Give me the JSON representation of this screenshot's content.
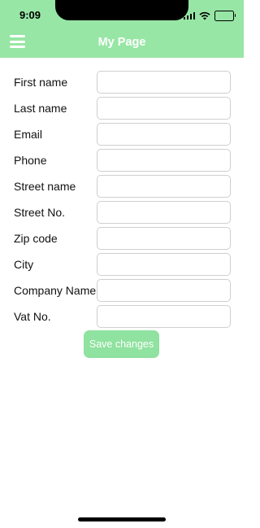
{
  "status_bar": {
    "time": "9:09",
    "icons": [
      "signal-icon",
      "wifi-icon",
      "battery-icon"
    ]
  },
  "header": {
    "title": "My Page",
    "menu_icon": "hamburger-menu-icon",
    "background": "#97e6a5"
  },
  "form": {
    "fields": [
      {
        "label": "First name",
        "value": ""
      },
      {
        "label": "Last name",
        "value": ""
      },
      {
        "label": "Email",
        "value": ""
      },
      {
        "label": "Phone",
        "value": ""
      },
      {
        "label": "Street name",
        "value": ""
      },
      {
        "label": "Street No.",
        "value": ""
      },
      {
        "label": "Zip code",
        "value": ""
      },
      {
        "label": "City",
        "value": ""
      },
      {
        "label": "Company Name",
        "value": ""
      },
      {
        "label": "Vat No.",
        "value": ""
      }
    ],
    "save_label": "Save changes",
    "accent": "#8fe29f"
  }
}
